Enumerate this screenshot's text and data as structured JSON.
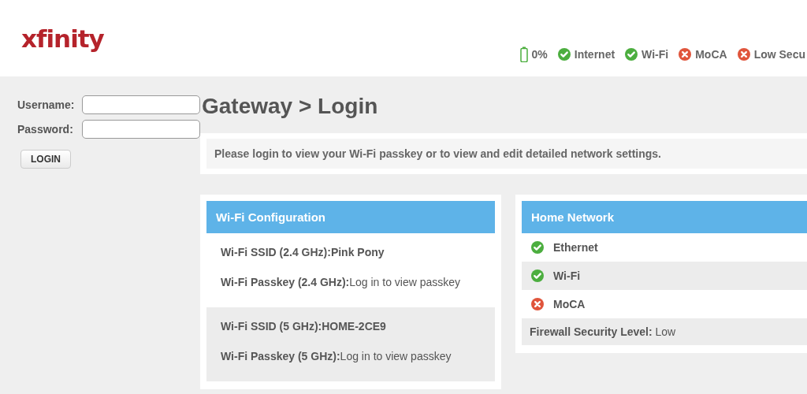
{
  "logo": "xfinity",
  "status_bar": {
    "battery": "0%",
    "items": [
      {
        "label": "Internet",
        "kind": "ok"
      },
      {
        "label": "Wi-Fi",
        "kind": "ok"
      },
      {
        "label": "MoCA",
        "kind": "error"
      },
      {
        "label": "Low Secu",
        "kind": "error"
      }
    ]
  },
  "login": {
    "username_label": "Username:",
    "password_label": "Password:",
    "button": "LOGIN"
  },
  "title": "Gateway > Login",
  "message": "Please login to view your Wi-Fi passkey or to view and edit detailed network settings.",
  "wifi": {
    "title": "Wi-Fi Configuration",
    "groups": [
      {
        "rows": [
          {
            "label": "Wi-Fi SSID (2.4 GHz):",
            "value": "Pink Pony",
            "value_bold": true
          },
          {
            "label": "Wi-Fi Passkey (2.4 GHz):",
            "value": "Log in to view passkey",
            "value_bold": false
          }
        ]
      },
      {
        "rows": [
          {
            "label": "Wi-Fi SSID (5 GHz):",
            "value": "HOME-2CE9",
            "value_bold": true
          },
          {
            "label": "Wi-Fi Passkey (5 GHz):",
            "value": "Log in to view passkey",
            "value_bold": false
          }
        ]
      }
    ]
  },
  "home_network": {
    "title": "Home Network",
    "items": [
      {
        "label": "Ethernet",
        "kind": "ok"
      },
      {
        "label": "Wi-Fi",
        "kind": "ok"
      },
      {
        "label": "MoCA",
        "kind": "error"
      }
    ],
    "firewall": {
      "label": "Firewall Security Level:",
      "value": "Low"
    }
  }
}
